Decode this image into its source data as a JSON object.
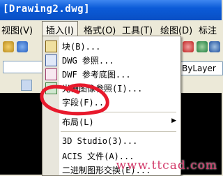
{
  "window": {
    "title": "[Drawing2.dwg]"
  },
  "menubar": {
    "items": [
      {
        "label": "视图(V)"
      },
      {
        "label": "插入(I)"
      },
      {
        "label": "格式(O)"
      },
      {
        "label": "工具(T)"
      },
      {
        "label": "绘图(D)"
      },
      {
        "label": "标注"
      }
    ]
  },
  "toolbar": {
    "layer_value": "ByLayer"
  },
  "insert_menu": {
    "items": [
      {
        "label": "块(B)...",
        "icon": "block-icon"
      },
      {
        "label": "DWG 参照...",
        "icon": "dwg-reference-icon"
      },
      {
        "label": "DWF 参考底图...",
        "icon": "dwf-underlay-icon"
      },
      {
        "label": "光栅图像参照(I)...",
        "icon": "raster-image-icon"
      },
      {
        "label": "字段(F)...",
        "icon": ""
      },
      {
        "label": "布局(L)",
        "icon": "",
        "submenu": true
      },
      {
        "label": "3D Studio(3)...",
        "icon": ""
      },
      {
        "label": "ACIS 文件(A)...",
        "icon": ""
      },
      {
        "label": "二进制图形交换(E)...",
        "icon": ""
      }
    ]
  },
  "annotation": {
    "color": "#e8192c"
  },
  "watermark": {
    "text": "www.ttcad.com"
  }
}
